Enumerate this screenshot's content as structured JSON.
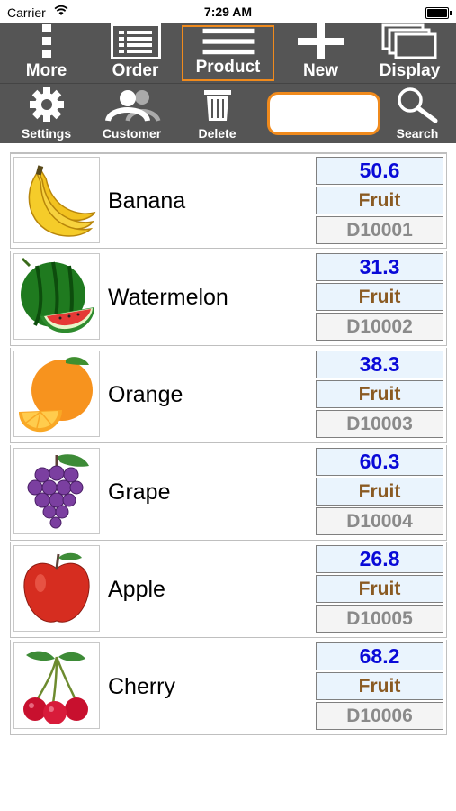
{
  "status": {
    "carrier": "Carrier",
    "time": "7:29 AM"
  },
  "toolbar": {
    "more": "More",
    "order": "Order",
    "product": "Product",
    "new": "New",
    "display": "Display"
  },
  "toolbar2": {
    "settings": "Settings",
    "customer": "Customer",
    "delete": "Delete",
    "search": "Search",
    "search_value": ""
  },
  "colors": {
    "accent": "#f08a1c",
    "toolbar": "#555555",
    "price": "#0a0ad8",
    "category": "#8a5a22",
    "code": "#8a8a8a"
  },
  "products": [
    {
      "name": "Banana",
      "price": "50.6",
      "category": "Fruit",
      "code": "D10001",
      "icon": "banana-image"
    },
    {
      "name": "Watermelon",
      "price": "31.3",
      "category": "Fruit",
      "code": "D10002",
      "icon": "watermelon-image"
    },
    {
      "name": "Orange",
      "price": "38.3",
      "category": "Fruit",
      "code": "D10003",
      "icon": "orange-image"
    },
    {
      "name": "Grape",
      "price": "60.3",
      "category": "Fruit",
      "code": "D10004",
      "icon": "grape-image"
    },
    {
      "name": "Apple",
      "price": "26.8",
      "category": "Fruit",
      "code": "D10005",
      "icon": "apple-image"
    },
    {
      "name": "Cherry",
      "price": "68.2",
      "category": "Fruit",
      "code": "D10006",
      "icon": "cherry-image"
    }
  ]
}
